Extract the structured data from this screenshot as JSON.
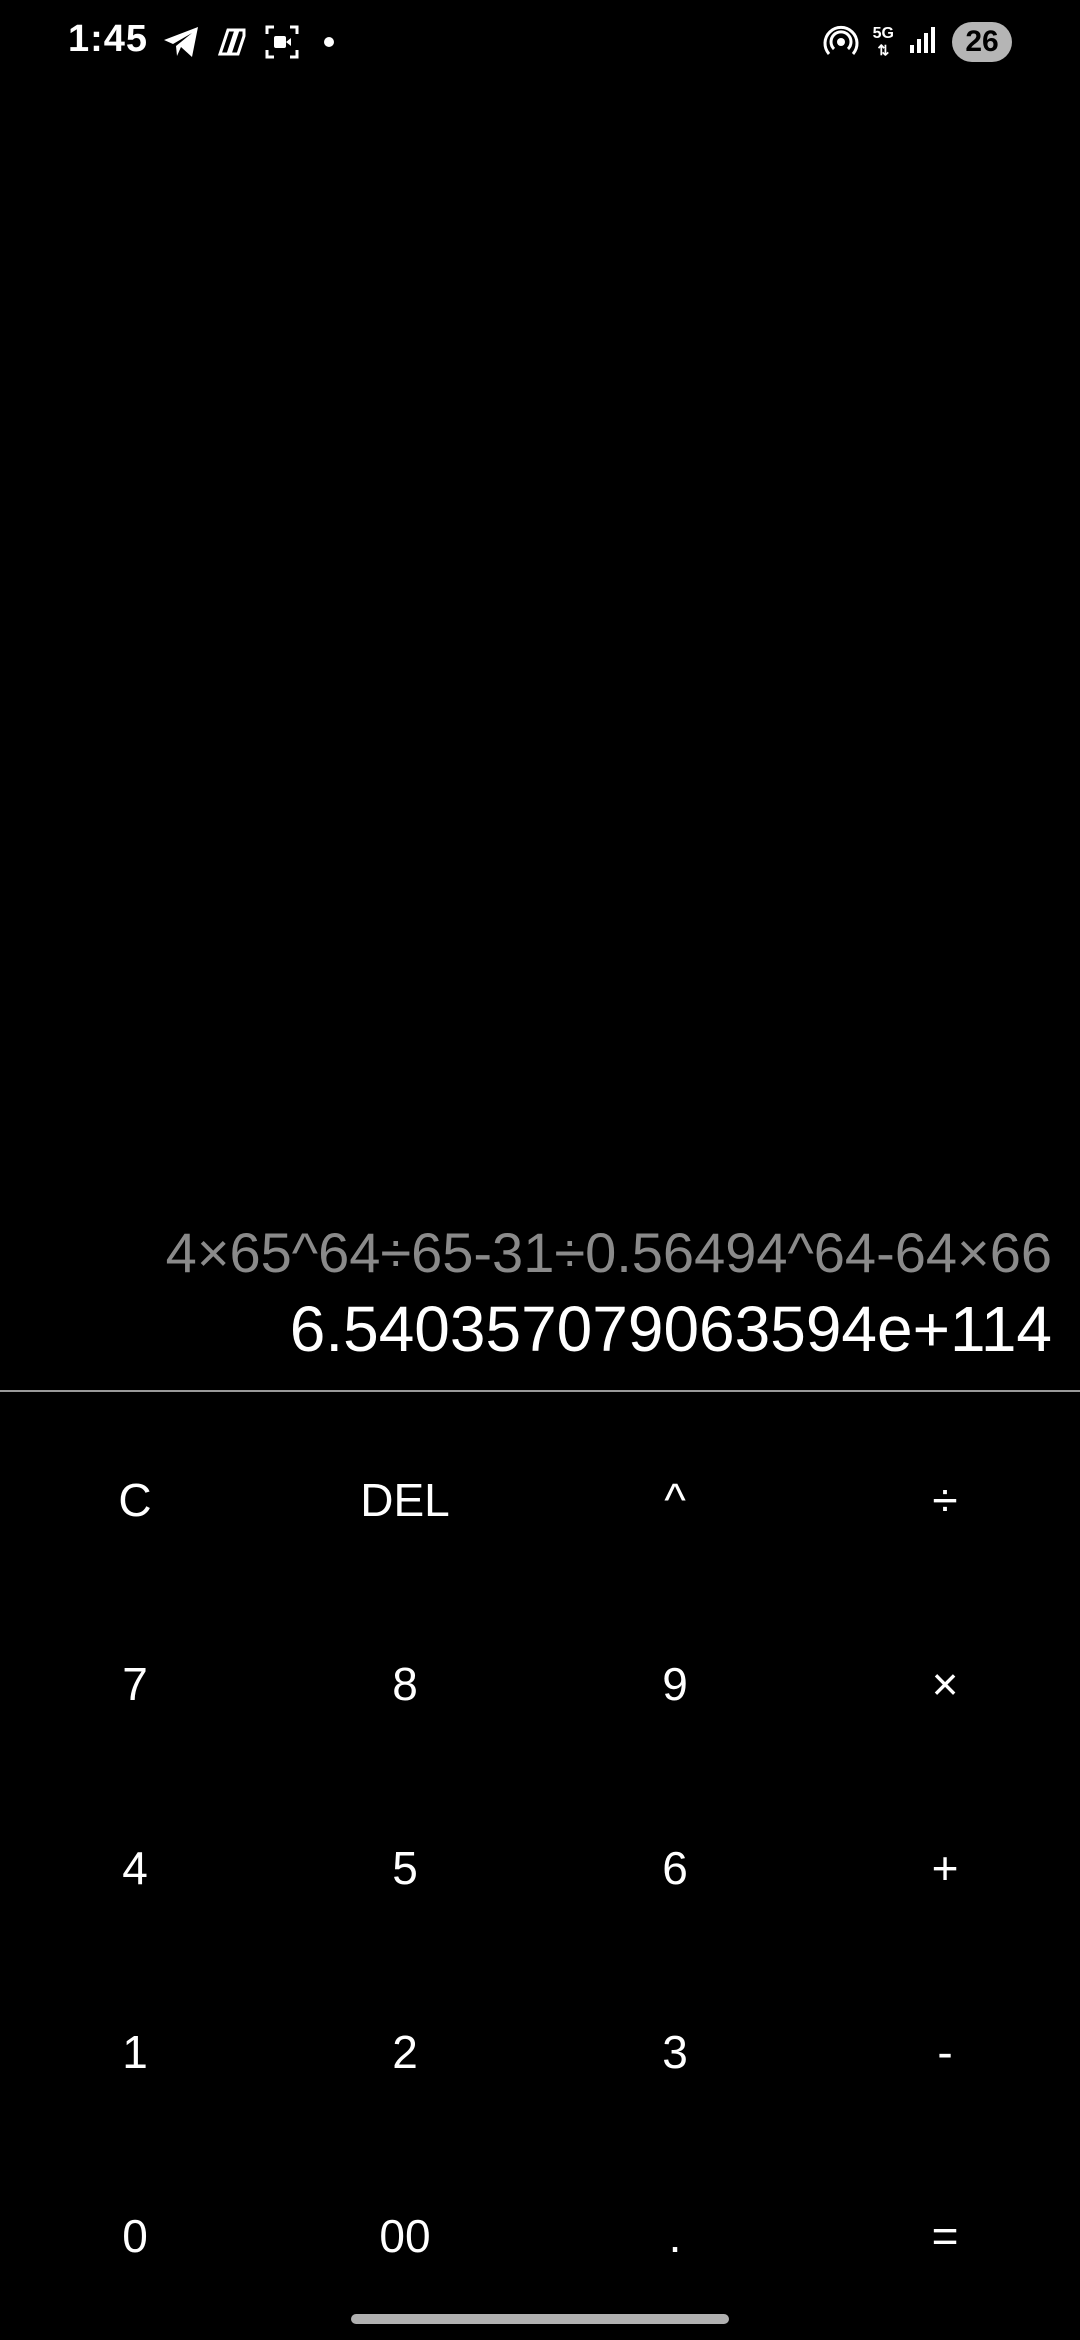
{
  "status_bar": {
    "time": "1:45",
    "network": "5G",
    "battery": "26",
    "icons": [
      "telegram-icon",
      "copilot-icon",
      "screen-record-icon",
      "notification-dot-icon",
      "hotspot-icon",
      "5g-icon",
      "signal-icon",
      "battery-icon"
    ]
  },
  "display": {
    "expression": "4×65^64÷65-31÷0.56494^64-64×66",
    "result": "6.540357079063594e+114"
  },
  "keypad": {
    "keys": [
      {
        "label": "C",
        "name": "clear-button"
      },
      {
        "label": "DEL",
        "name": "delete-button"
      },
      {
        "label": "^",
        "name": "power-button"
      },
      {
        "label": "÷",
        "name": "divide-button"
      },
      {
        "label": "7",
        "name": "digit-7-button"
      },
      {
        "label": "8",
        "name": "digit-8-button"
      },
      {
        "label": "9",
        "name": "digit-9-button"
      },
      {
        "label": "×",
        "name": "multiply-button"
      },
      {
        "label": "4",
        "name": "digit-4-button"
      },
      {
        "label": "5",
        "name": "digit-5-button"
      },
      {
        "label": "6",
        "name": "digit-6-button"
      },
      {
        "label": "+",
        "name": "add-button"
      },
      {
        "label": "1",
        "name": "digit-1-button"
      },
      {
        "label": "2",
        "name": "digit-2-button"
      },
      {
        "label": "3",
        "name": "digit-3-button"
      },
      {
        "label": "-",
        "name": "subtract-button"
      },
      {
        "label": "0",
        "name": "digit-0-button"
      },
      {
        "label": "00",
        "name": "double-zero-button"
      },
      {
        "label": ".",
        "name": "decimal-button"
      },
      {
        "label": "=",
        "name": "equals-button"
      }
    ]
  },
  "colors": {
    "background": "#000000",
    "expression_text": "#8a8a8a",
    "result_text": "#ffffff",
    "divider": "#9a9a9a"
  }
}
